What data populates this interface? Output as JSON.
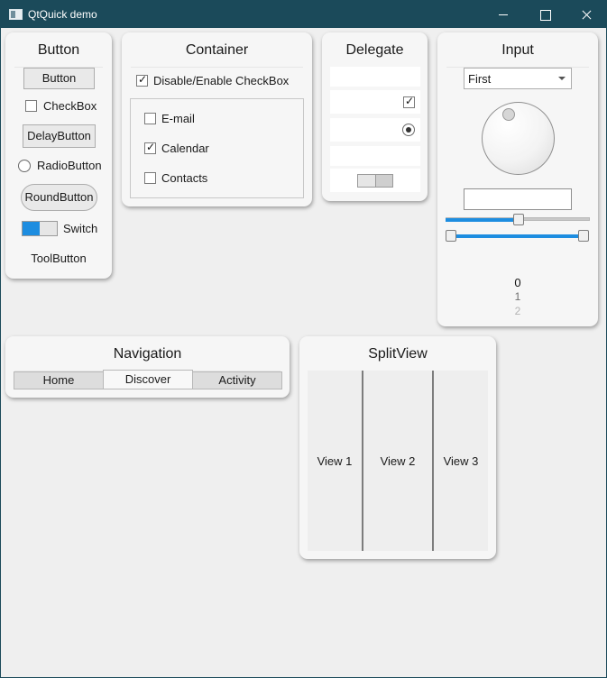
{
  "window": {
    "title": "QtQuick demo"
  },
  "button_panel": {
    "title": "Button",
    "button_label": "Button",
    "checkbox_label": "CheckBox",
    "checkbox_checked": false,
    "delay_button_label": "DelayButton",
    "radio_label": "RadioButton",
    "radio_checked": false,
    "round_button_label": "RoundButton",
    "switch_label": "Switch",
    "switch_on": true,
    "tool_button_label": "ToolButton"
  },
  "container_panel": {
    "title": "Container",
    "master_checkbox_label": "Disable/Enable CheckBox",
    "master_checked": true,
    "group_items": [
      {
        "label": "E-mail",
        "checked": false
      },
      {
        "label": "Calendar",
        "checked": true
      },
      {
        "label": "Contacts",
        "checked": false
      }
    ]
  },
  "delegate_panel": {
    "title": "Delegate",
    "rows": [
      "item",
      "check",
      "radio",
      "item",
      "switch"
    ],
    "check_checked": true,
    "radio_checked": true,
    "switch_on": false
  },
  "input_panel": {
    "title": "Input",
    "combo_value": "First",
    "text_field_value": "",
    "slider_value": 0.5,
    "range_first": 0.0,
    "range_second": 1.0,
    "tumbler_items": [
      "0",
      "1",
      "2"
    ],
    "tumbler_current": "0"
  },
  "navigation_panel": {
    "title": "Navigation",
    "tabs": [
      {
        "label": "Home",
        "active": false
      },
      {
        "label": "Discover",
        "active": true
      },
      {
        "label": "Activity",
        "active": false
      }
    ]
  },
  "splitview_panel": {
    "title": "SplitView",
    "views": [
      "View 1",
      "View 2",
      "View 3"
    ]
  },
  "colors": {
    "titlebar": "#1b4a5a",
    "accent": "#1d8de0",
    "background": "#efefef",
    "card": "#f6f6f6"
  }
}
